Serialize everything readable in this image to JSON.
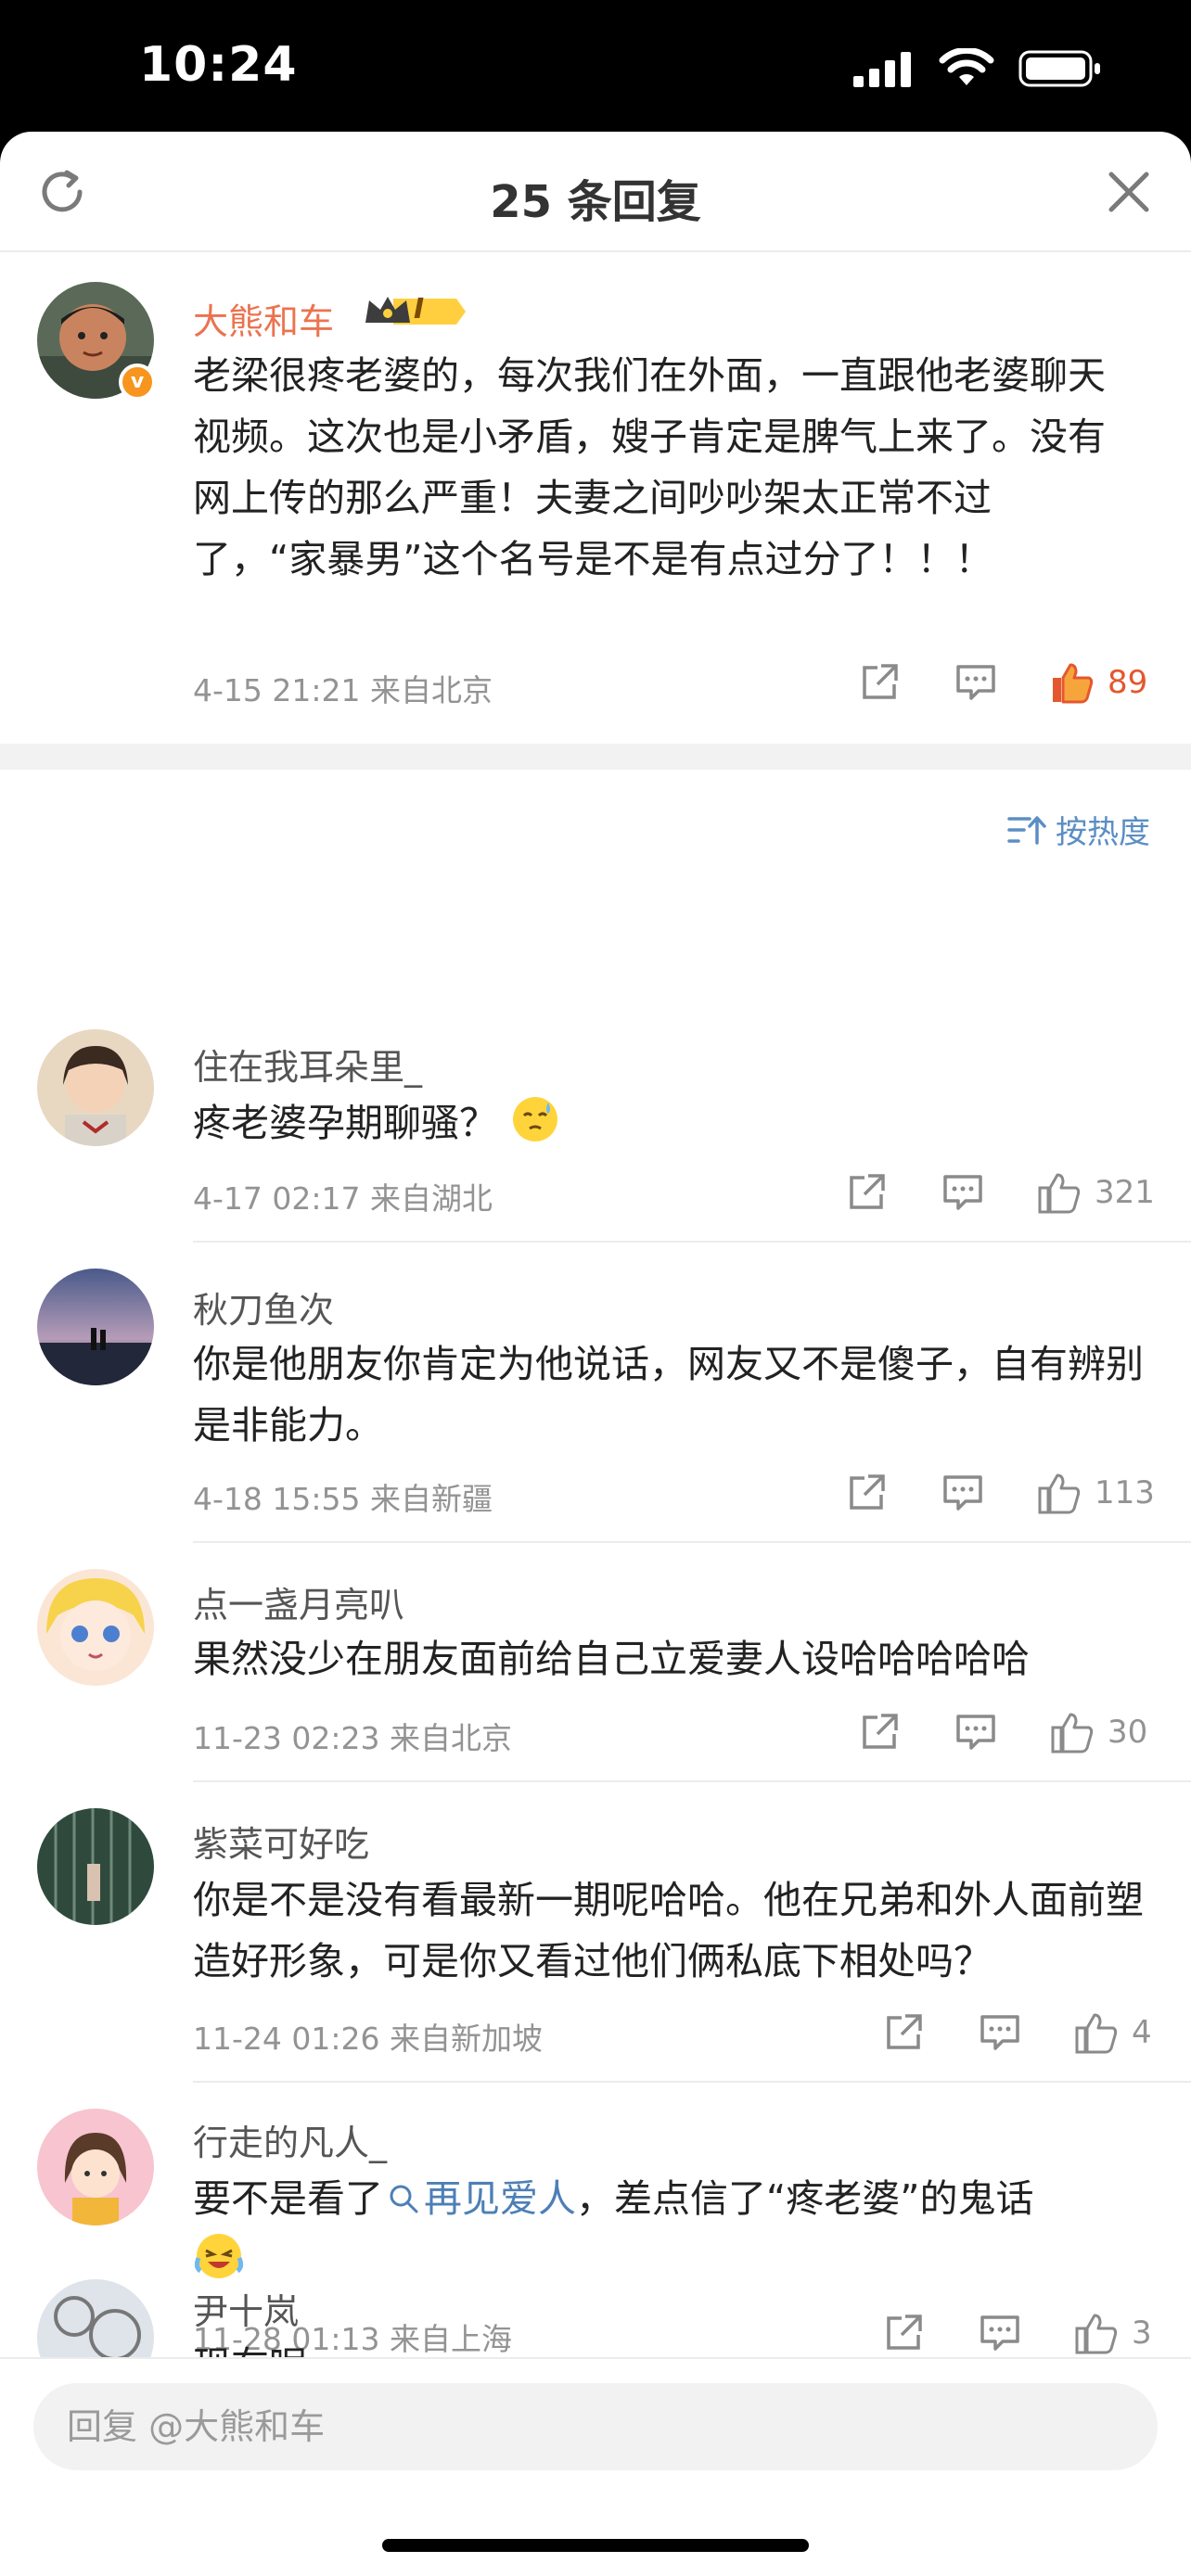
{
  "status": {
    "time": "10:24"
  },
  "header": {
    "title": "25 条回复"
  },
  "main_comment": {
    "user": "大熊和车",
    "badge_level": "I",
    "verified_mark": "v",
    "text": "老梁很疼老婆的，每次我们在外面，一直跟他老婆聊天视频。这次也是小矛盾，嫂子肯定是脾气上来了。没有网上传的那么严重！夫妻之间吵吵架太正常不过了，“家暴男”这个名号是不是有点过分了！！！",
    "meta": "4-15 21:21  来自北京",
    "likes": "89"
  },
  "sort": {
    "label": "按热度"
  },
  "replies": [
    {
      "user": "住在我耳朵里_",
      "text": "疼老婆孕期聊骚？",
      "meta": "4-17 02:17  来自湖北",
      "likes": "321"
    },
    {
      "user": "秋刀鱼次",
      "text": "你是他朋友你肯定为他说话，网友又不是傻子，自有辨别是非能力。",
      "meta": "4-18 15:55  来自新疆",
      "likes": "113"
    },
    {
      "user": "点一盏月亮叭",
      "text": "果然没少在朋友面前给自己立爱妻人设哈哈哈哈哈",
      "meta": "11-23 02:23  来自北京",
      "likes": "30"
    },
    {
      "user": "紫菜可好吃",
      "text": "你是不是没有看最新一期呢哈哈。他在兄弟和外人面前塑造好形象，可是你又看过他们俩私底下相处吗？",
      "meta": "11-24 01:26  来自新加坡",
      "likes": "4"
    },
    {
      "user": "行走的凡人_",
      "text_before": "要不是看了",
      "topic": "再见爱人",
      "text_after": "，差点信了“疼老婆”的鬼话",
      "meta": "11-28 01:13  来自上海",
      "likes": "3"
    },
    {
      "user": "尹十岚",
      "text": "现在呢"
    }
  ],
  "bottom": {
    "placeholder": "回复 @大熊和车"
  },
  "colors": {
    "accent_orange": "#eb7350",
    "link_blue": "#4d7fb6",
    "like_active": "#f26b2f"
  }
}
